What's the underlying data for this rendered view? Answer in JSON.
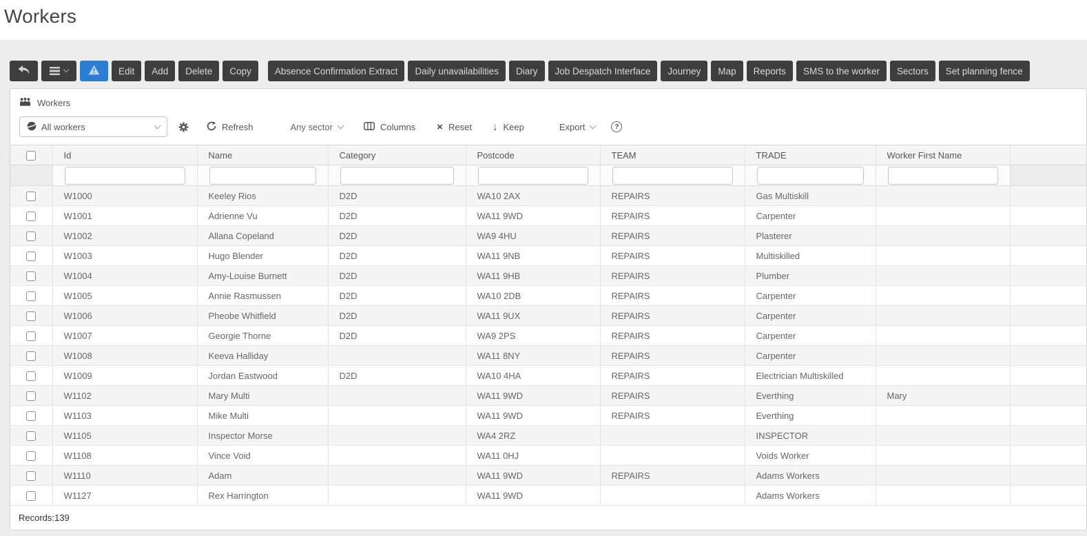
{
  "page": {
    "title": "Workers",
    "records": "Records:139"
  },
  "toolbar": {
    "buttons": [
      "Edit",
      "Add",
      "Delete",
      "Copy",
      "Absence Confirmation Extract",
      "Daily unavailabilities",
      "Diary",
      "Job Despatch Interface",
      "Journey",
      "Map",
      "Reports",
      "SMS to the worker",
      "Sectors",
      "Set planning fence"
    ]
  },
  "panel": {
    "title": "Workers",
    "filterbar": {
      "view": "All workers",
      "refresh": "Refresh",
      "sector": "Any sector",
      "columns": "Columns",
      "reset": "Reset",
      "keep": "Keep",
      "export": "Export"
    },
    "table": {
      "columns": [
        "Id",
        "Name",
        "Category",
        "Postcode",
        "TEAM",
        "TRADE",
        "Worker First Name"
      ],
      "rows": [
        [
          "W1000",
          "Keeley Rios",
          "D2D",
          "WA10 2AX",
          "REPAIRS",
          "Gas Multiskill",
          ""
        ],
        [
          "W1001",
          "Adrienne Vu",
          "D2D",
          "WA11 9WD",
          "REPAIRS",
          "Carpenter",
          ""
        ],
        [
          "W1002",
          "Allana Copeland",
          "D2D",
          "WA9 4HU",
          "REPAIRS",
          "Plasterer",
          ""
        ],
        [
          "W1003",
          "Hugo Blender",
          "D2D",
          "WA11 9NB",
          "REPAIRS",
          "Multiskilled",
          ""
        ],
        [
          "W1004",
          "Amy-Louise Burnett",
          "D2D",
          "WA11 9HB",
          "REPAIRS",
          "Plumber",
          ""
        ],
        [
          "W1005",
          "Annie Rasmussen",
          "D2D",
          "WA10 2DB",
          "REPAIRS",
          "Carpenter",
          ""
        ],
        [
          "W1006",
          "Pheobe Whitfield",
          "D2D",
          "WA11 9UX",
          "REPAIRS",
          "Carpenter",
          ""
        ],
        [
          "W1007",
          "Georgie Thorne",
          "D2D",
          "WA9 2PS",
          "REPAIRS",
          "Carpenter",
          ""
        ],
        [
          "W1008",
          "Keeva Halliday",
          "",
          "WA11 8NY",
          "REPAIRS",
          "Carpenter",
          ""
        ],
        [
          "W1009",
          "Jordan Eastwood",
          "D2D",
          "WA10 4HA",
          "REPAIRS",
          "Electrician Multiskilled",
          ""
        ],
        [
          "W1102",
          "Mary Multi",
          "",
          "WA11 9WD",
          "REPAIRS",
          "Everthing",
          "Mary"
        ],
        [
          "W1103",
          "Mike Multi",
          "",
          "WA11 9WD",
          "REPAIRS",
          "Everthing",
          ""
        ],
        [
          "W1105",
          "Inspector Morse",
          "",
          "WA4 2RZ",
          "",
          "INSPECTOR",
          ""
        ],
        [
          "W1108",
          "Vince Void",
          "",
          "WA11 0HJ",
          "",
          "Voids Worker",
          ""
        ],
        [
          "W1110",
          "Adam",
          "",
          "WA11 9WD",
          "REPAIRS",
          "Adams Workers",
          ""
        ],
        [
          "W1127",
          "Rex Harrington",
          "",
          "WA11 9WD",
          "",
          "Adams Workers",
          ""
        ]
      ]
    }
  },
  "icons": {
    "back": "reply-arrow",
    "menu": "hamburger",
    "menu_caret": "chevron-down",
    "warning": "warning-triangle",
    "panel": "people",
    "view": "globe",
    "settings": "gear",
    "refresh": "circular-arrow",
    "sector_caret": "chevron-down",
    "columns": "columns-box",
    "export_caret": "chevron-down",
    "glyph_reset": "×",
    "glyph_keep": "↓",
    "glyph_help": "?"
  },
  "colors": {
    "toolbar_button": "#3e3e3e",
    "accent_blue": "#2d7dd2",
    "page_bg": "#ededed",
    "header_bg": "#f4f4f4",
    "row_alt_bg": "#f5f5f5",
    "border": "#dcdcdc"
  }
}
